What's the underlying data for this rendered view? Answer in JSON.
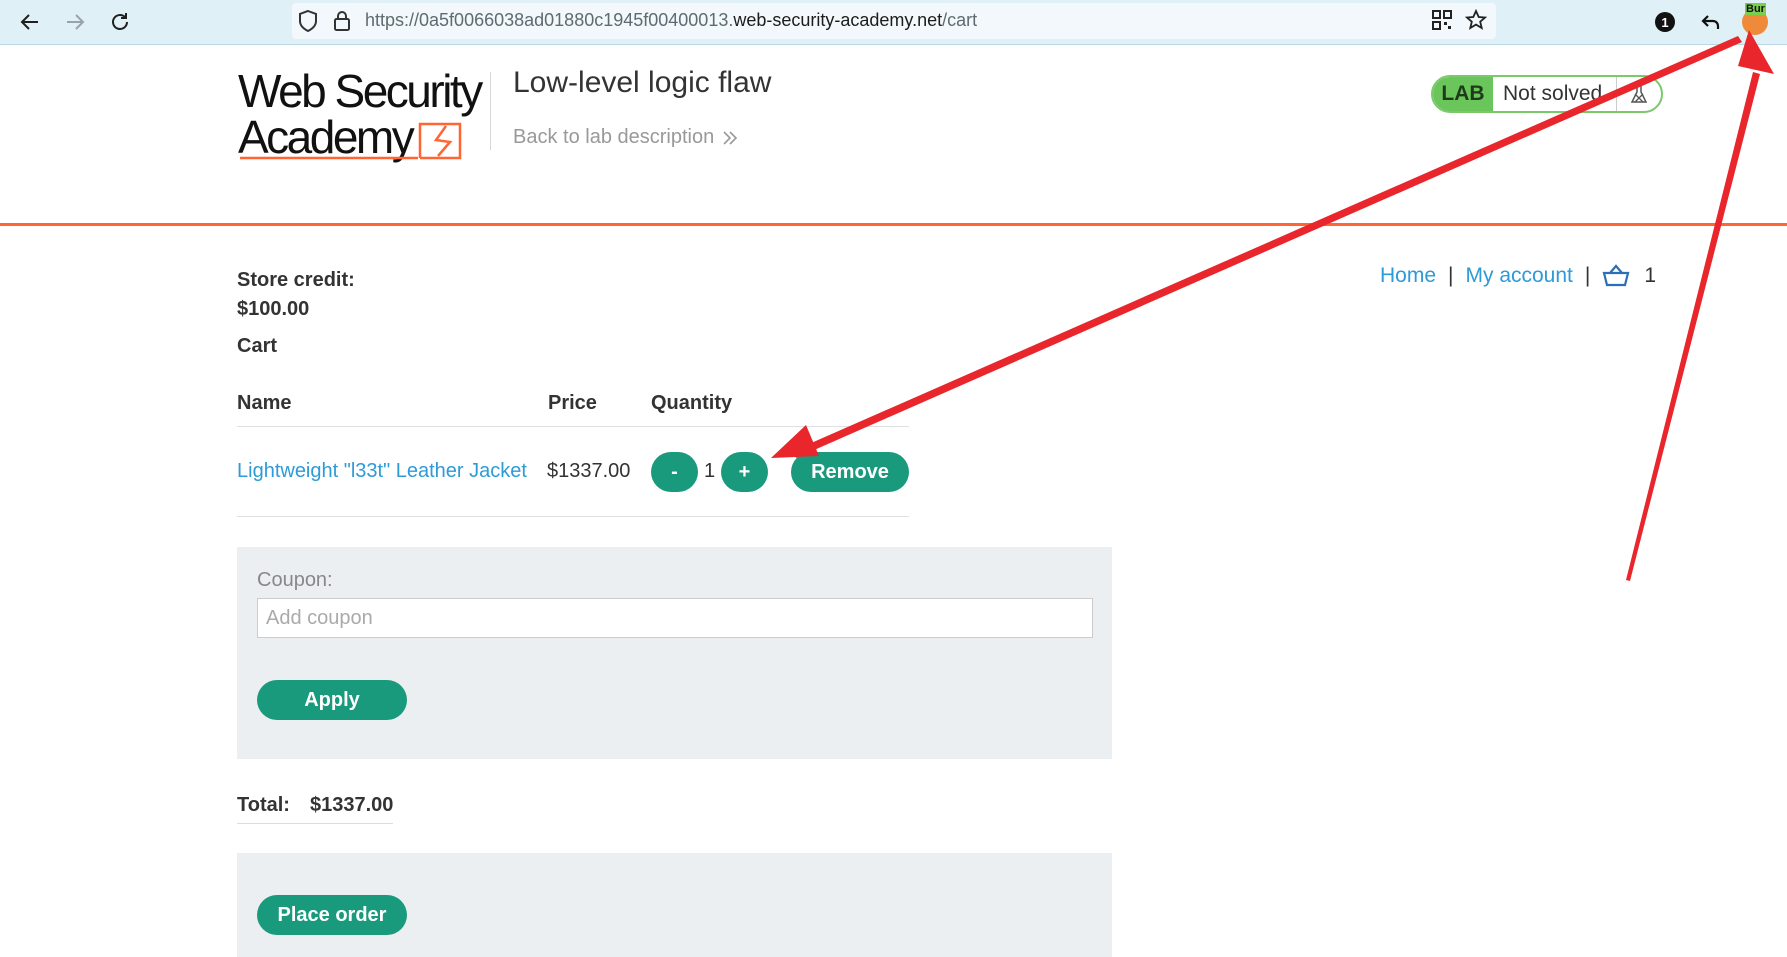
{
  "browser": {
    "url_prefix": "https://0a5f0066038ad01880c1945f00400013.",
    "url_domain": "web-security-academy.net",
    "url_path": "/cart",
    "extension_badge": "1",
    "extension_label": "Bur"
  },
  "header": {
    "logo_line1": "Web Security",
    "logo_line2": "Academy",
    "lab_title": "Low-level logic flaw",
    "back_link": "Back to lab description",
    "lab_badge": "LAB",
    "lab_status": "Not solved"
  },
  "store_nav": {
    "home": "Home",
    "separator": "|",
    "account": "My account",
    "cart_count": "1"
  },
  "store_credit": {
    "label": "Store credit:",
    "value": "$100.00"
  },
  "cart": {
    "heading": "Cart",
    "columns": [
      "Name",
      "Price",
      "Quantity"
    ],
    "items": [
      {
        "name": "Lightweight \"l33t\" Leather Jacket",
        "price": "$1337.00",
        "quantity": "1",
        "decrement_label": "-",
        "increment_label": "+",
        "remove_label": "Remove"
      }
    ]
  },
  "coupon": {
    "label": "Coupon:",
    "placeholder": "Add coupon",
    "apply_label": "Apply"
  },
  "total": {
    "label": "Total:",
    "value": "$1337.00"
  },
  "order": {
    "place_order_label": "Place order"
  },
  "colors": {
    "accent": "#1a9a7c",
    "link": "#2d9bd7",
    "header_rule": "#ff6633",
    "lab_green": "#6ac55a",
    "annotation_arrow": "#e8262b"
  }
}
